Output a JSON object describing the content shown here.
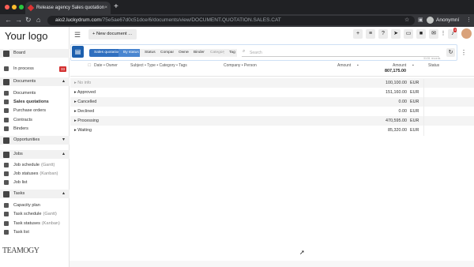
{
  "browser": {
    "tab_title": "Release agency Sales quotation",
    "new_tab": "+",
    "url_host": "aio2.luckydrum.com",
    "url_path": "/75e5ae67d0c51dce/6/documents/view/DOCUMENT.QUOTATION.SALES.CAT",
    "profile_name": "Anonymní",
    "window_dot_colors": [
      "#ff5f57",
      "#febc2e",
      "#28c840"
    ]
  },
  "sidebar": {
    "logo": "Your logo",
    "brand": "TEAMOGY",
    "items": [
      {
        "label": "Board",
        "icon": "grid-icon",
        "type": "section"
      },
      {
        "label": "In process",
        "icon": "flow-icon",
        "type": "item",
        "badge": "33"
      },
      {
        "label": "Documents",
        "icon": "document-icon",
        "type": "section",
        "expanded": true
      },
      {
        "label": "Documents",
        "icon": "doc-small-icon",
        "type": "item"
      },
      {
        "label": "Sales quotations",
        "icon": "doc-small-icon",
        "type": "item",
        "active": true
      },
      {
        "label": "Purchase orders",
        "icon": "doc-small-icon",
        "type": "item"
      },
      {
        "label": "Contracts",
        "icon": "doc-small-icon",
        "type": "item"
      },
      {
        "label": "Binders",
        "icon": "doc-small-icon",
        "type": "item"
      },
      {
        "label": "Opportunities",
        "icon": "target-icon",
        "type": "section",
        "collapsed": true
      },
      {
        "label": "Jobs",
        "icon": "target-icon",
        "type": "section",
        "expanded": true
      },
      {
        "label": "Job schedule",
        "suffix": "(Gantt)",
        "icon": "dot-icon",
        "type": "item"
      },
      {
        "label": "Job statuses",
        "suffix": "(Kanban)",
        "icon": "dot-icon",
        "type": "item"
      },
      {
        "label": "Job list",
        "icon": "dot-icon",
        "type": "item"
      },
      {
        "label": "Tasks",
        "icon": "tasks-icon",
        "type": "section",
        "expanded": true
      },
      {
        "label": "Capacity plan",
        "icon": "list-icon",
        "type": "item"
      },
      {
        "label": "Task schedule",
        "suffix": "(Gantt)",
        "icon": "list-icon",
        "type": "item"
      },
      {
        "label": "Task statuses",
        "suffix": "(Kanban)",
        "icon": "list-icon",
        "type": "item"
      },
      {
        "label": "Task list",
        "icon": "list-icon",
        "type": "item"
      }
    ]
  },
  "toolbar": {
    "new_document": "+ New document ...",
    "notif_badge": "3"
  },
  "filter": {
    "breadcrumbs": [
      "Sales quotations",
      "By status",
      "Status",
      "Company",
      "Owner",
      "Binder",
      "Category",
      "Tag"
    ],
    "search_placeholder": "Search",
    "records": "31/31 records"
  },
  "table": {
    "headers": {
      "date_owner": "Date • Owner",
      "subject": "Subject • Type • Category • Tags",
      "company": "Company • Person",
      "amount": "Amount",
      "amount2": "Amount",
      "status": "Status"
    },
    "total": "807,175.00",
    "rows": [
      {
        "label": "No info",
        "amount": "100,100.00",
        "currency": "EUR"
      },
      {
        "label": "Approved",
        "amount": "151,160.00",
        "currency": "EUR"
      },
      {
        "label": "Cancelled",
        "amount": "0.00",
        "currency": "EUR"
      },
      {
        "label": "Declined",
        "amount": "0.00",
        "currency": "EUR"
      },
      {
        "label": "Processing",
        "amount": "470,595.00",
        "currency": "EUR"
      },
      {
        "label": "Waiting",
        "amount": "85,320.00",
        "currency": "EUR"
      }
    ]
  }
}
